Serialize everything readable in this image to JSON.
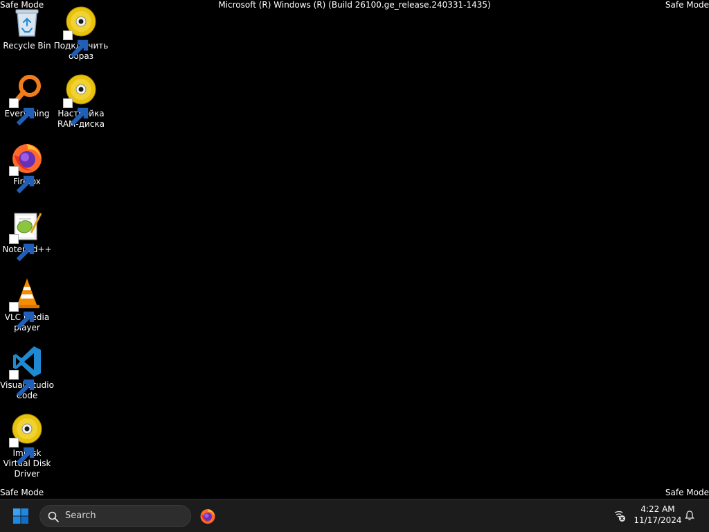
{
  "watermarks": {
    "top_left": "Safe Mode",
    "top_right": "Safe Mode",
    "bottom_left": "Safe Mode",
    "bottom_right": "Safe Mode",
    "build": "Microsoft (R) Windows (R) (Build 26100.ge_release.240331-1435)"
  },
  "desktop": {
    "icons": [
      {
        "label": "Recycle Bin",
        "icon": "recycle-bin-icon"
      },
      {
        "label": "Подключить образ",
        "icon": "disc-icon"
      },
      {
        "label": "Everything",
        "icon": "everything-icon"
      },
      {
        "label": "Настройка RAM-диска",
        "icon": "disc-icon"
      },
      {
        "label": "Firefox",
        "icon": "firefox-icon"
      },
      {
        "label": "Notepad++",
        "icon": "notepad-plus-plus-icon"
      },
      {
        "label": "VLC media player",
        "icon": "vlc-icon"
      },
      {
        "label": "Visual Studio Code",
        "icon": "vscode-icon"
      },
      {
        "label": "ImDisk Virtual Disk Driver",
        "icon": "disc-icon"
      }
    ]
  },
  "taskbar": {
    "search_placeholder": "Search",
    "pinned": [
      "firefox-icon"
    ],
    "clock_time": "4:22 AM",
    "clock_date": "11/17/2024",
    "tray_icons": [
      "network-disconnected-icon",
      "notification-bell-icon"
    ]
  },
  "colors": {
    "desktop_bg": "#000000",
    "taskbar_bg": "#1c1c1c",
    "start_blue": "#0078d4"
  }
}
